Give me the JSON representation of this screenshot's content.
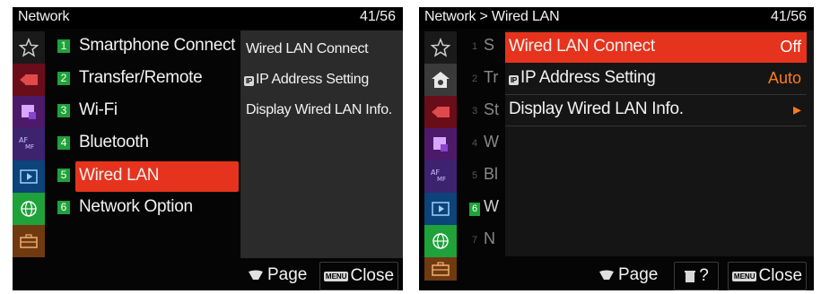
{
  "left_screen": {
    "header": {
      "title": "Network",
      "page": "41/56"
    },
    "tabs": [
      {
        "icon": "star-icon",
        "color": "#2b2b2b"
      },
      {
        "icon": "camera-shoot-icon",
        "color": "#7a0f1c"
      },
      {
        "icon": "image-quality-icon",
        "color": "#5b1f7a"
      },
      {
        "icon": "af-mf-icon",
        "color": "#4a2b80"
      },
      {
        "icon": "playback-icon",
        "color": "#0e4f86"
      },
      {
        "icon": "globe-network-icon",
        "color": "#1fa23a"
      },
      {
        "icon": "toolbox-icon",
        "color": "#8a4a14"
      }
    ],
    "menu": [
      {
        "num": "1",
        "label": "Smartphone Connect"
      },
      {
        "num": "2",
        "label": "Transfer/Remote"
      },
      {
        "num": "3",
        "label": "Wi-Fi"
      },
      {
        "num": "4",
        "label": "Bluetooth"
      },
      {
        "num": "5",
        "label": "Wired LAN",
        "selected": true
      },
      {
        "num": "6",
        "label": "Network Option"
      }
    ],
    "help_items": [
      "Wired LAN Connect",
      "IP Address Setting",
      "Display Wired LAN Info."
    ],
    "footer": {
      "page_label": "Page",
      "close_label": "Close",
      "menu_chip": "MENU"
    }
  },
  "right_screen": {
    "header": {
      "title": "Network > Wired LAN",
      "page": "41/56"
    },
    "stubs": [
      {
        "num": "1",
        "text": "S"
      },
      {
        "num": "2",
        "text": "Tr"
      },
      {
        "num": "3",
        "text": "St"
      },
      {
        "num": "4",
        "text": "W"
      },
      {
        "num": "5",
        "text": "Bl"
      },
      {
        "num": "6",
        "text": "W",
        "active": true
      },
      {
        "num": "7",
        "text": "N"
      }
    ],
    "settings": [
      {
        "label": "Wired LAN Connect",
        "value": "Off",
        "selected": true
      },
      {
        "label": "IP Address Setting",
        "value": "Auto"
      },
      {
        "label": "Display Wired LAN Info.",
        "value": "▸"
      }
    ],
    "footer": {
      "page_label": "Page",
      "help_label": "?",
      "close_label": "Close",
      "menu_chip": "MENU"
    }
  },
  "colors": {
    "selection": "#e6331d",
    "accent_green": "#1fa23a",
    "value_orange": "#ff7a1a"
  }
}
